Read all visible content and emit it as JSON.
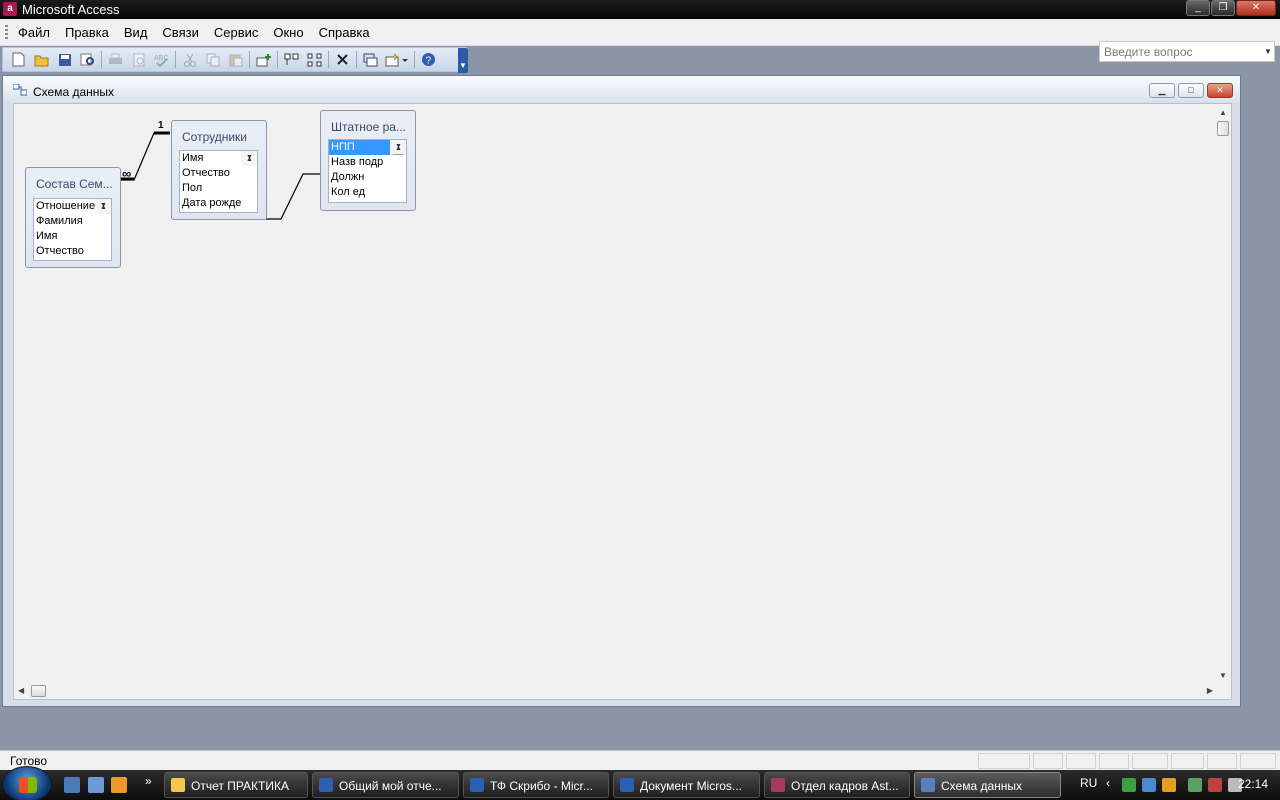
{
  "app": {
    "title": "Microsoft Access",
    "icon_name": "access-icon"
  },
  "menu": {
    "items": [
      {
        "label": "Файл"
      },
      {
        "label": "Правка"
      },
      {
        "label": "Вид"
      },
      {
        "label": "Связи"
      },
      {
        "label": "Сервис"
      },
      {
        "label": "Окно"
      },
      {
        "label": "Справка"
      }
    ],
    "help_placeholder": "Введите вопрос"
  },
  "toolbar": {
    "buttons": [
      "new-icon",
      "open-icon",
      "save-icon",
      "search-icon",
      "print-icon",
      "print-preview-icon",
      "spelling-icon",
      "cut-icon",
      "copy-icon",
      "paste-icon",
      "show-table-icon",
      "show-direct-icon",
      "show-all-icon",
      "delete-icon",
      "new-object-icon",
      "office-links-icon",
      "help-icon"
    ]
  },
  "child_window": {
    "title": "Схема данных"
  },
  "tables": {
    "family": {
      "title": "Состав Сем...",
      "fields": [
        "Отношение",
        "Фамилия",
        "Имя",
        "Отчество"
      ]
    },
    "employees": {
      "title": "Сотрудники",
      "fields": [
        "Имя",
        "Отчество",
        "Пол",
        "Дата рожде"
      ]
    },
    "staff": {
      "title": "Штатное ра...",
      "fields": [
        "НПП",
        "Назв подр",
        "Должн",
        "Кол ед"
      ],
      "selected_field": "НПП"
    }
  },
  "relations": {
    "one_label": "1",
    "many_label": "∞"
  },
  "status": {
    "text": "Готово"
  },
  "taskbar": {
    "tasks": [
      {
        "label": "Отчет ПРАКТИКА",
        "color": "#f2c94c"
      },
      {
        "label": "Общий мой отче...",
        "color": "#2b5fb4"
      },
      {
        "label": "ТФ Скрибо - Micr...",
        "color": "#2b5fb4"
      },
      {
        "label": "Документ Micros...",
        "color": "#2b5fb4"
      },
      {
        "label": "Отдел кадров Ast...",
        "color": "#a83a62"
      },
      {
        "label": "Схема данных",
        "color": "#5a7fc0"
      }
    ],
    "lang": "RU",
    "clock": "22:14",
    "more_label": "»"
  }
}
